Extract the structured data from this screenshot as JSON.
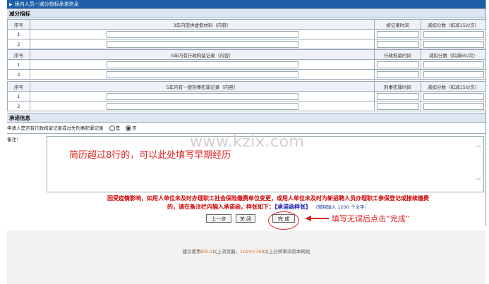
{
  "title": "境内人员一减分指标承诺信息",
  "section1": "减分指标",
  "tables": [
    {
      "cols": [
        "序号",
        "3年内提供虚假材料（内容）",
        "被记录时间",
        "减扣分数（扣减150/次）"
      ],
      "rows": [
        "1",
        "2"
      ]
    },
    {
      "cols": [
        "序号",
        "5年内有行政拘留记录（内容）",
        "行政拘留时间",
        "减扣分数（扣减60/次）"
      ],
      "rows": [
        "1",
        "2"
      ]
    },
    {
      "cols": [
        "序号",
        "5年内有一般刑事犯罪记录（内容）",
        "刑事犯罪时间",
        "减扣分数（扣减150/次）"
      ],
      "rows": [
        "1",
        "2"
      ]
    }
  ],
  "section2": "承诺信息",
  "promise": {
    "question": "申请人是否有行政拘留记录或过失刑事犯罪记录",
    "yes": "是",
    "no": "否",
    "selected": "否"
  },
  "remark": {
    "label": "备注：",
    "note": "简历超过8行的，可以此处填写早期经历",
    "watermark": "www.kzix.com"
  },
  "warning": {
    "line1": "因受疫情影响，如用人单位未及时办理职工社会保险缴费单位变更，或用人单位未及时为新招聘人员办理职工参保登记或接续缴费",
    "line2": "的，请在备注栏内输入承诺函，样张如下：",
    "link": "【承诺函样张】",
    "tip": "（限制输入 1200 个文字）"
  },
  "buttons": {
    "prev": "上一步",
    "close": "关 闭",
    "finish": "完 成"
  },
  "hint": "填写无误后点击“完成”",
  "footer": {
    "pre": "建议使用",
    "ie": "IE9.0",
    "mid": "以上浏览器，",
    "res": "1024×768",
    "post": "以上分辨率浏览本网站"
  },
  "colors": {
    "titlebar": "#1e5fa8",
    "annotation": "#e02020"
  }
}
